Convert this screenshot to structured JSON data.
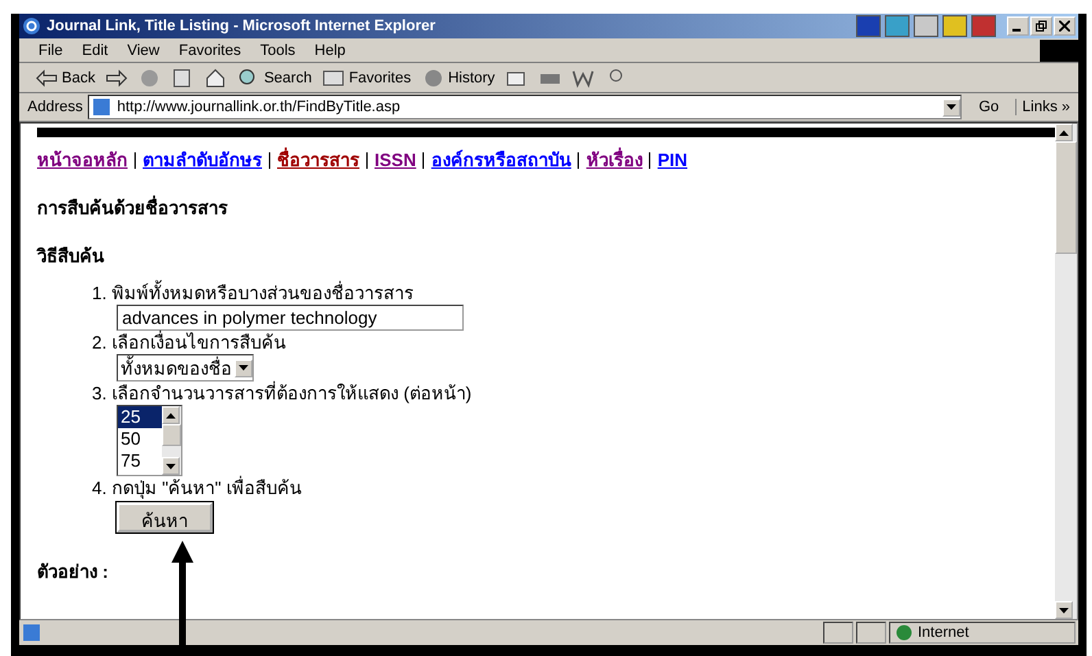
{
  "window": {
    "title": "Journal Link, Title Listing - Microsoft Internet Explorer"
  },
  "menu": [
    "File",
    "Edit",
    "View",
    "Favorites",
    "Tools",
    "Help"
  ],
  "toolbar": [
    {
      "kind": "back",
      "label": "Back"
    },
    {
      "kind": "forward"
    },
    {
      "kind": "stop"
    },
    {
      "kind": "refresh"
    },
    {
      "kind": "home"
    },
    {
      "kind": "search",
      "label": "Search"
    },
    {
      "kind": "favorites",
      "label": "Favorites"
    },
    {
      "kind": "history",
      "label": "History"
    },
    {
      "kind": "mail"
    },
    {
      "kind": "print"
    },
    {
      "kind": "edit"
    },
    {
      "kind": "messenger"
    }
  ],
  "address": {
    "label": "Address",
    "url": "http://www.journallink.or.th/FindByTitle.asp",
    "go": "Go",
    "links": "Links »"
  },
  "nav": [
    {
      "label": "หน้าจอหลัก",
      "kind": "visited"
    },
    {
      "label": "ตามลำดับอักษร",
      "kind": "link"
    },
    {
      "label": "ชื่อวารสาร",
      "kind": "current"
    },
    {
      "label": "ISSN",
      "kind": "visited"
    },
    {
      "label": "องค์กรหรือสถาบัน",
      "kind": "link"
    },
    {
      "label": "หัวเรื่อง",
      "kind": "visited"
    },
    {
      "label": "PIN",
      "kind": "link"
    }
  ],
  "heading": "การสืบค้นด้วยชื่อวารสาร",
  "method_heading": "วิธีสืบค้น",
  "steps": [
    {
      "kind": "input",
      "label": "1. พิมพ์ทั้งหมดหรือบางส่วนของชื่อวารสาร",
      "value": "advances in polymer technology"
    },
    {
      "kind": "select",
      "label": "2. เลือกเงื่อนไขการสืบค้น",
      "value": "ทั้งหมดของชื่อ"
    },
    {
      "kind": "listbox",
      "label": "3. เลือกจำนวนวารสารที่ต้องการให้แสดง (ต่อหน้า)",
      "options": [
        {
          "label": "25",
          "selected": true
        },
        {
          "label": "50",
          "selected": false
        },
        {
          "label": "75",
          "selected": false
        }
      ]
    },
    {
      "kind": "button",
      "label": "4. กดปุ่ม \"ค้นหา\" เพื่อสืบค้น",
      "value": "ค้นหา"
    }
  ],
  "example_heading": "ตัวอย่าง :",
  "status_bar": {
    "zone": "Internet"
  }
}
